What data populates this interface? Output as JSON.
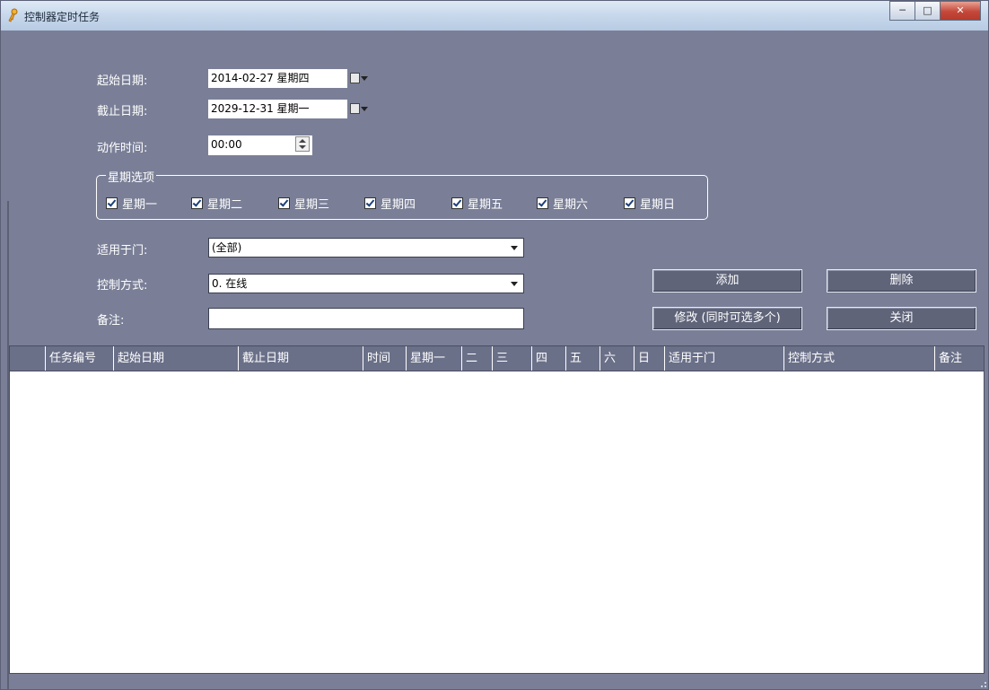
{
  "window": {
    "title": "控制器定时任务"
  },
  "form": {
    "start_date_label": "起始日期:",
    "start_date_value": "2014-02-27 星期四",
    "end_date_label": "截止日期:",
    "end_date_value": "2029-12-31 星期一",
    "time_label": "动作时间:",
    "time_value": "00:00",
    "weekday_group_label": "星期选项",
    "weekdays": [
      {
        "label": "星期一",
        "checked": true
      },
      {
        "label": "星期二",
        "checked": true
      },
      {
        "label": "星期三",
        "checked": true
      },
      {
        "label": "星期四",
        "checked": true
      },
      {
        "label": "星期五",
        "checked": true
      },
      {
        "label": "星期六",
        "checked": true
      },
      {
        "label": "星期日",
        "checked": true
      }
    ],
    "door_label": "适用于门:",
    "door_value": "(全部)",
    "control_label": "控制方式:",
    "control_value": "0. 在线",
    "note_label": "备注:",
    "note_value": ""
  },
  "buttons": {
    "add": "添加",
    "delete": "删除",
    "modify": "修改 (同时可选多个)",
    "close": "关闭"
  },
  "table": {
    "columns": [
      "任务编号",
      "起始日期",
      "截止日期",
      "时间",
      "星期一",
      "二",
      "三",
      "四",
      "五",
      "六",
      "日",
      "适用于门",
      "控制方式",
      "备注"
    ],
    "rows": []
  },
  "icons": {
    "app": "key-icon",
    "calendar": "calendar-icon",
    "dropdown": "chevron-down-icon",
    "spinner": "spinner-icon"
  }
}
